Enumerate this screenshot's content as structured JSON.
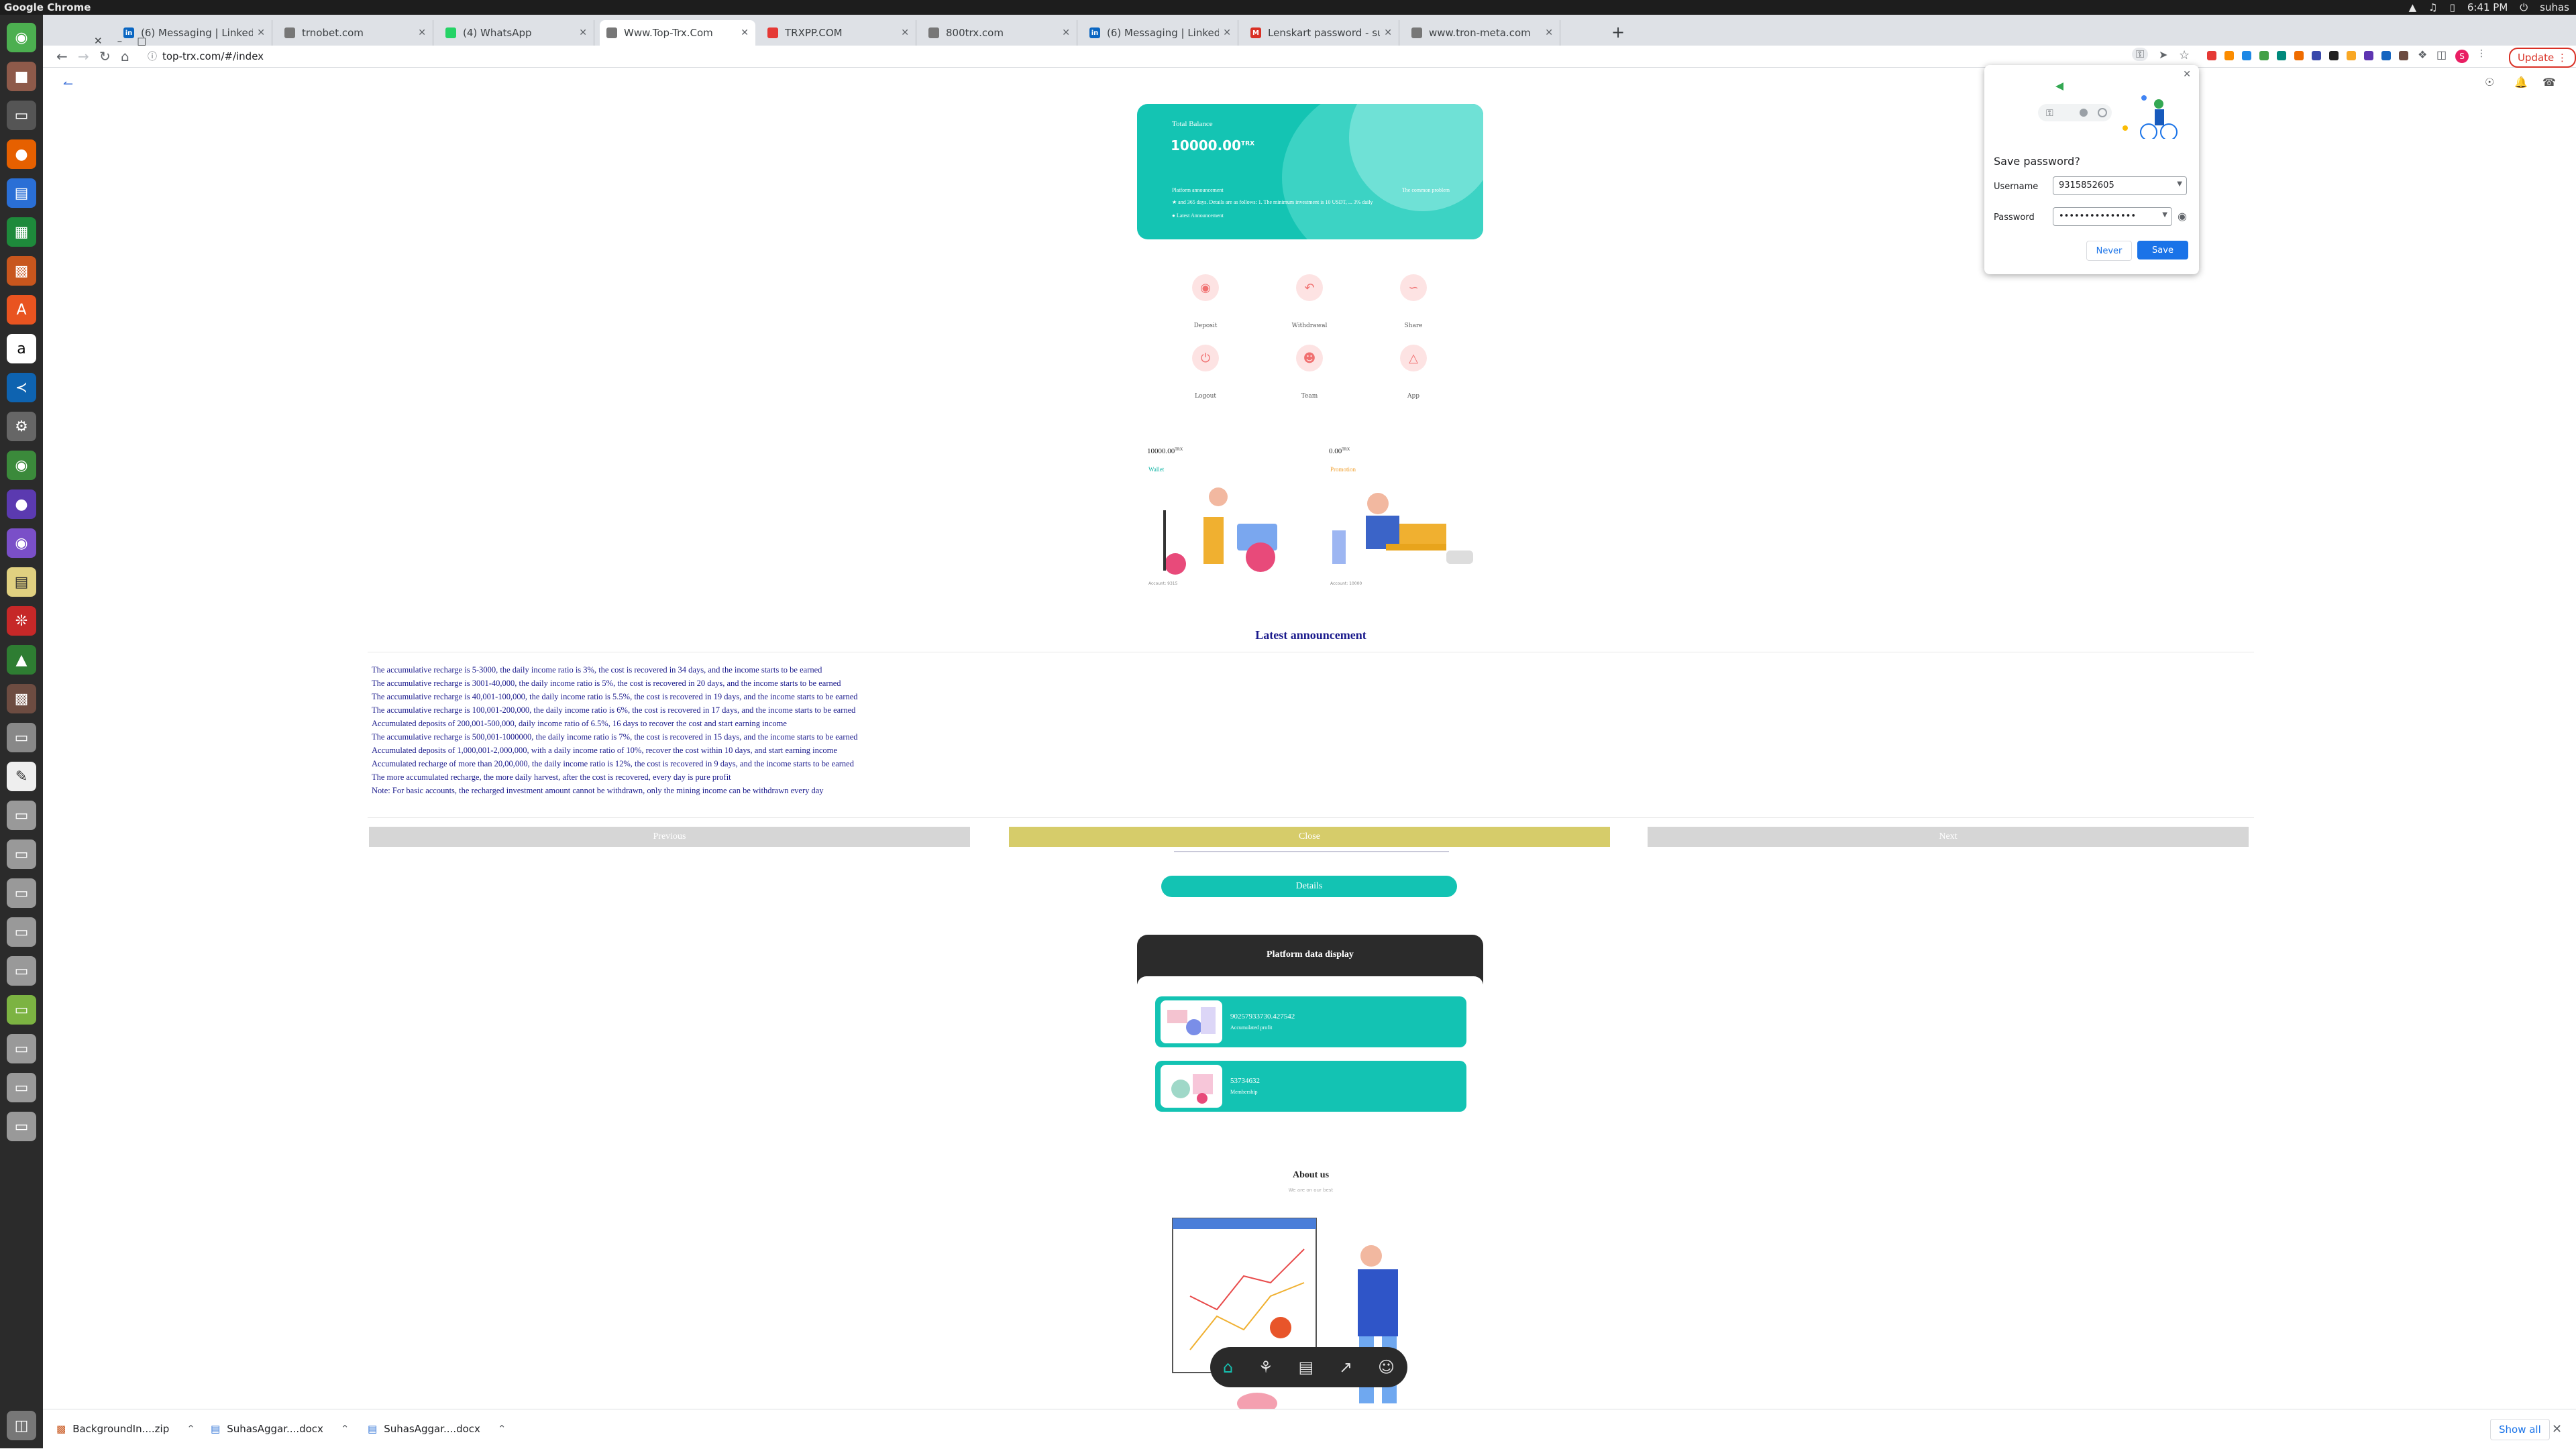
{
  "os": {
    "app_title": "Google Chrome",
    "time": "6:41 PM",
    "user": "suhas"
  },
  "tabs": [
    {
      "label": "(6) Messaging | LinkedIn",
      "fav_color": "#0a66c2",
      "fav_text": "in"
    },
    {
      "label": "trnobet.com",
      "fav_color": "#777777",
      "fav_text": ""
    },
    {
      "label": "(4) WhatsApp",
      "fav_color": "#25d366",
      "fav_text": ""
    },
    {
      "label": "Www.Top-Trx.Com",
      "fav_color": "#777777",
      "fav_text": ""
    },
    {
      "label": "TRXPP.COM",
      "fav_color": "#e53935",
      "fav_text": ""
    },
    {
      "label": "800trx.com",
      "fav_color": "#777777",
      "fav_text": ""
    },
    {
      "label": "(6) Messaging | LinkedIn",
      "fav_color": "#0a66c2",
      "fav_text": "in"
    },
    {
      "label": "Lenskart password - suha",
      "fav_color": "#d93025",
      "fav_text": "M"
    },
    {
      "label": "www.tron-meta.com",
      "fav_color": "#777777",
      "fav_text": ""
    }
  ],
  "toolbar": {
    "url": "top-trx.com/#/index",
    "update_label": "Update"
  },
  "card": {
    "title": "Total Balance",
    "balance": "10000.00",
    "unit": "TRX",
    "platform_announcement": "Platform announcement",
    "common_problem": "The common problem",
    "ticker": "and 365 days. Details are as follows: 1. The minimum investment is 10 USDT, ... 3% daily",
    "latest_link": "Latest Announcement"
  },
  "grid": [
    {
      "label": "Deposit",
      "icon": "wallet-icon"
    },
    {
      "label": "Withdrawal",
      "icon": "undo-icon"
    },
    {
      "label": "Share",
      "icon": "share-icon"
    },
    {
      "label": "Logout",
      "icon": "power-icon"
    },
    {
      "label": "Team",
      "icon": "team-icon"
    },
    {
      "label": "App",
      "icon": "app-icon"
    }
  ],
  "wallets": [
    {
      "amount": "10000.00",
      "unit": "TRX",
      "label": "Wallet",
      "caption": "Account: 9315",
      "label_color": "#12b5a5"
    },
    {
      "amount": "0.00",
      "unit": "TRX",
      "label": "Promotion",
      "caption": "Account: 10000",
      "label_color": "#f0a030"
    }
  ],
  "announcement": {
    "heading": "Latest announcement",
    "lines": [
      "The accumulative recharge is 5-3000, the daily income ratio is 3%, the cost is recovered in 34 days, and the income starts to be earned",
      "The accumulative recharge is 3001-40,000, the daily income ratio is 5%, the cost is recovered in 20 days, and the income starts to be earned",
      "The accumulative recharge is 40,001-100,000, the daily income ratio is 5.5%, the cost is recovered in 19 days, and the income starts to be earned",
      "The accumulative recharge is 100,001-200,000, the daily income ratio is 6%, the cost is recovered in 17 days, and the income starts to be earned",
      "Accumulated deposits of 200,001-500,000, daily income ratio of 6.5%, 16 days to recover the cost and start earning income",
      "The accumulative recharge is 500,001-1000000, the daily income ratio is 7%, the cost is recovered in 15 days, and the income starts to be earned",
      "Accumulated deposits of 1,000,001-2,000,000, with a daily income ratio of 10%, recover the cost within 10 days, and start earning income",
      "Accumulated recharge of more than 20,00,000, the daily income ratio is 12%, the cost is recovered in 9 days, and the income starts to be earned",
      "The more accumulated recharge, the more daily harvest, after the cost is recovered, every day is pure profit",
      "Note: For basic accounts, the recharged investment amount cannot be withdrawn, only the mining income can be withdrawn every day"
    ],
    "previous_label": "Previous",
    "close_label": "Close",
    "next_label": "Next"
  },
  "details_label": "Details",
  "platform": {
    "heading": "Platform data display",
    "stats": [
      {
        "value": "90257933730.427542",
        "label": "Accumulated profit"
      },
      {
        "value": "53734632",
        "label": "Membership"
      }
    ]
  },
  "about": {
    "heading": "About us",
    "subheading": "We are on our best"
  },
  "bottom_nav": [
    "home-icon",
    "team-icon",
    "chart-icon",
    "share-icon",
    "user-icon"
  ],
  "password_popup": {
    "title": "Save password?",
    "username_label": "Username",
    "username_value": "9315852605",
    "password_label": "Password",
    "password_value": "•••••••••••••••",
    "never_label": "Never",
    "save_label": "Save"
  },
  "downloads": [
    {
      "name": "BackgroundIn....zip"
    },
    {
      "name": "SuhasAggar....docx"
    },
    {
      "name": "SuhasAggar....docx"
    }
  ],
  "show_all_label": "Show all"
}
